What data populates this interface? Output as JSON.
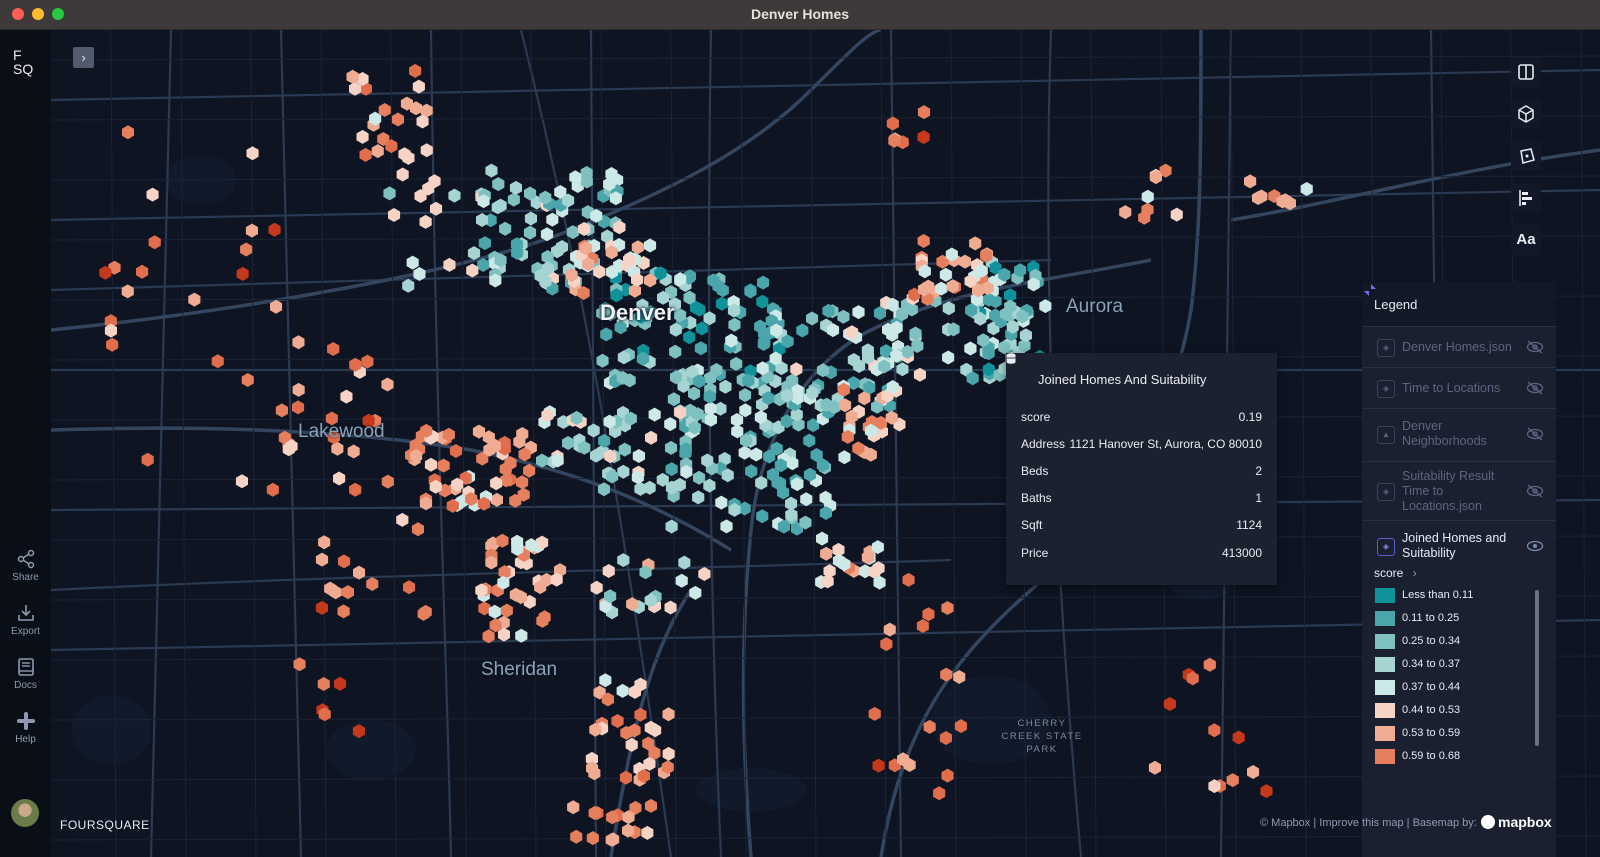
{
  "window": {
    "title": "Denver Homes"
  },
  "sidebar": {
    "logo_line1": "F",
    "logo_line2": "SQ",
    "items": [
      {
        "label": "Share",
        "icon": "share-icon"
      },
      {
        "label": "Export",
        "icon": "download-icon"
      },
      {
        "label": "Docs",
        "icon": "book-icon"
      },
      {
        "label": "Help",
        "icon": "slack-icon"
      }
    ]
  },
  "map": {
    "collapse_glyph": "›",
    "labels": {
      "denver": "Denver",
      "aurora": "Aurora",
      "lakewood": "Lakewood",
      "sheridan": "Sheridan",
      "park": "CHERRY\nCREEK STATE\nPARK"
    },
    "brand": "FOURSQUARE",
    "attribution": "© Mapbox | Improve this map | Basemap by:",
    "mapbox_logo": "mapbox"
  },
  "toolbar": {
    "items": [
      {
        "icon": "split-map-icon"
      },
      {
        "icon": "3d-cube-icon"
      },
      {
        "icon": "draw-polygon-icon"
      },
      {
        "icon": "legend-bars-icon"
      },
      {
        "label": "Aa",
        "icon": "text-labels-icon"
      }
    ]
  },
  "legend": {
    "title": "Legend",
    "layers": [
      {
        "name": "Denver Homes.json",
        "visible": false
      },
      {
        "name": "Time to Locations",
        "visible": false
      },
      {
        "name": "Denver Neighborhoods",
        "visible": false
      },
      {
        "name": "Suitability Result Time to Locations.json",
        "visible": false
      },
      {
        "name": "Joined Homes and Suitability",
        "visible": true
      }
    ],
    "field": "score",
    "items": [
      {
        "label": "Less than 0.11",
        "color": "#10929a"
      },
      {
        "label": "0.11 to 0.25",
        "color": "#4aa6aa"
      },
      {
        "label": "0.25 to 0.34",
        "color": "#7fc0c0"
      },
      {
        "label": "0.34 to 0.37",
        "color": "#a5d4d3"
      },
      {
        "label": "0.37 to 0.44",
        "color": "#cde9e7"
      },
      {
        "label": "0.44 to 0.53",
        "color": "#f7d3c5"
      },
      {
        "label": "0.53 to 0.59",
        "color": "#f0ac92"
      },
      {
        "label": "0.59 to 0.68",
        "color": "#e57f5e"
      }
    ]
  },
  "tooltip": {
    "title": "Joined Homes And Suitability",
    "rows": [
      {
        "key": "score",
        "value": "0.19"
      },
      {
        "key": "Address",
        "value": "1121 Hanover St, Aurora, CO 80010"
      },
      {
        "key": "Beds",
        "value": "2"
      },
      {
        "key": "Baths",
        "value": "1"
      },
      {
        "key": "Sqft",
        "value": "1124"
      },
      {
        "key": "Price",
        "value": "413000"
      }
    ]
  },
  "colors": {
    "teal_dark": "#0e8f97",
    "teal": "#4ea7ab",
    "teal_light": "#a9d7d5",
    "salmon_light": "#f5c6b3",
    "salmon": "#ec9a7c",
    "orange": "#e06d4c",
    "red": "#c4381c",
    "map_bg": "#0e1422",
    "road": "#2a3a52"
  }
}
